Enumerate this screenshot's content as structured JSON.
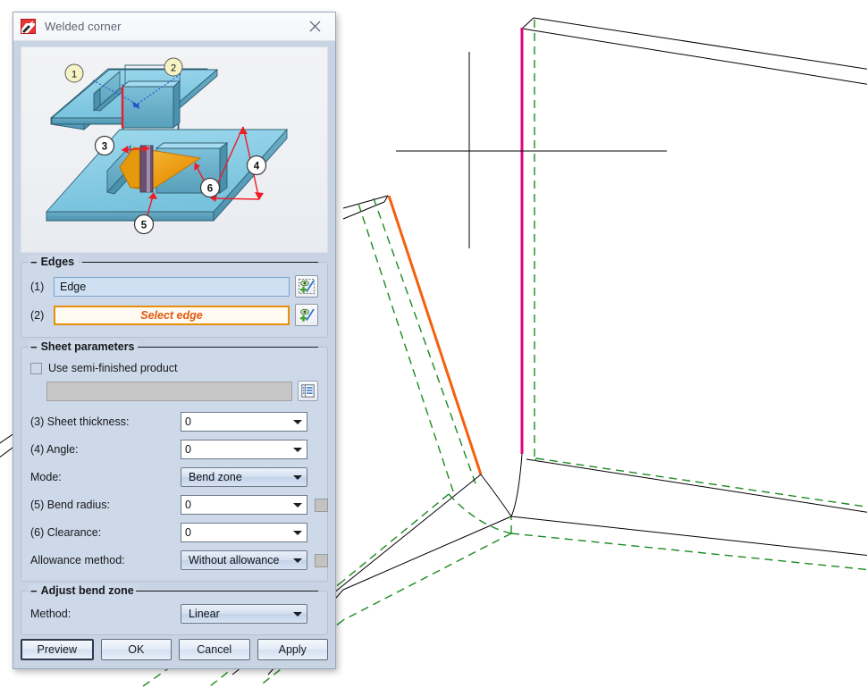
{
  "window": {
    "title": "Welded corner",
    "icon": "welded-corner-icon",
    "close_label": "✕"
  },
  "illustration": {
    "name": "welded-corner-diagram",
    "callouts": [
      "1",
      "2",
      "3",
      "4",
      "5",
      "6"
    ],
    "colors": {
      "sheet_top": "#8fd0e8",
      "sheet_side": "#5ea5bf",
      "weld_fill": "#f0a81e",
      "weld_dark": "#6b4f73",
      "dimension": "#ee1c24",
      "leader": "#2255cc",
      "callout_fill": "#f5f2c4"
    }
  },
  "edges": {
    "group_label": "Edges",
    "collapse_glyph": "−",
    "rows": [
      {
        "index": "(1)",
        "value": "Edge",
        "state": "filled",
        "pick_icon": "pick-edge-icon"
      },
      {
        "index": "(2)",
        "value": "Select edge",
        "state": "prompt",
        "pick_icon": "pick-edge-icon"
      }
    ]
  },
  "sheet_parameters": {
    "group_label": "Sheet parameters",
    "collapse_glyph": "−",
    "use_semi_finished": {
      "label": "Use semi-finished product",
      "checked": false
    },
    "semi_finished_value": "",
    "lookup_icon": "table-lookup-icon",
    "fields": [
      {
        "label": "(3) Sheet thickness:",
        "value": "0",
        "type": "editable",
        "swatch": false
      },
      {
        "label": "(4) Angle:",
        "value": "0",
        "type": "editable",
        "swatch": false
      },
      {
        "label": "Mode:",
        "value": "Bend zone",
        "type": "readonly",
        "swatch": false
      },
      {
        "label": "(5) Bend radius:",
        "value": "0",
        "type": "editable",
        "swatch": true
      },
      {
        "label": "(6) Clearance:",
        "value": "0",
        "type": "editable",
        "swatch": false
      },
      {
        "label": "Allowance method:",
        "value": "Without allowance",
        "type": "readonly",
        "swatch": true
      }
    ]
  },
  "adjust_bend_zone": {
    "group_label": "Adjust bend zone",
    "collapse_glyph": "−",
    "fields": [
      {
        "label": "Method:",
        "value": "Linear",
        "type": "readonly",
        "swatch": false
      }
    ]
  },
  "buttons": [
    {
      "label": "Preview",
      "default": true
    },
    {
      "label": "OK",
      "default": false
    },
    {
      "label": "Cancel",
      "default": false
    },
    {
      "label": "Apply",
      "default": false
    }
  ],
  "viewport": {
    "name": "cad-3d-viewport",
    "background": "#ffffff",
    "colors": {
      "model_edge": "#000000",
      "selected_edge_magenta": "#e6007e",
      "selected_edge_orange": "#f4600c",
      "unfold_dashed": "#1d8a22",
      "crosshair": "#000000"
    }
  }
}
